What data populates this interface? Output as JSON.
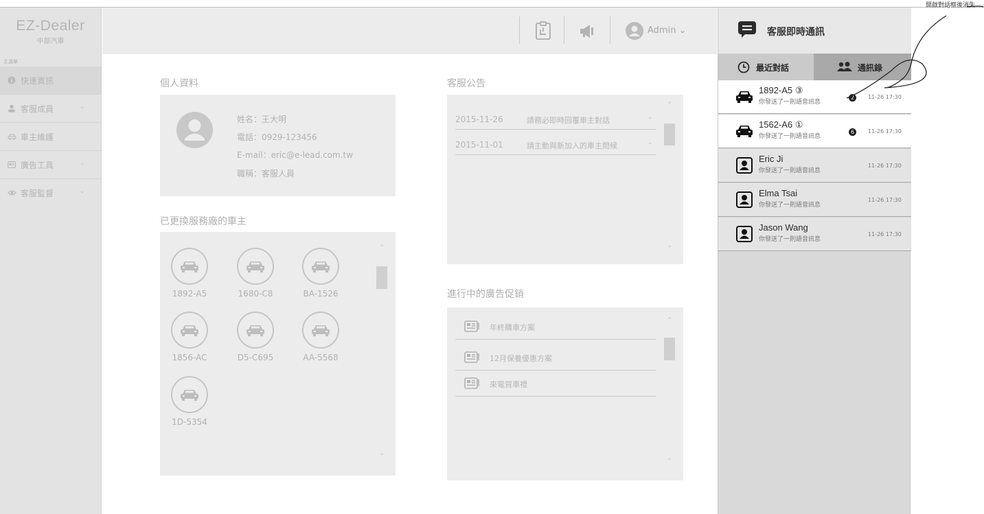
{
  "sidebar": {
    "logo_title": "EZ-Dealer",
    "logo_subtitle": "中部汽車",
    "menu_caption": "主選單",
    "items": [
      {
        "label": "快速資訊",
        "icon": "info-icon"
      },
      {
        "label": "客服成員",
        "icon": "person-icon"
      },
      {
        "label": "車主維護",
        "icon": "car-icon"
      },
      {
        "label": "廣告工具",
        "icon": "ad-icon"
      },
      {
        "label": "客服監督",
        "icon": "eye-icon"
      }
    ]
  },
  "header": {
    "admin_label": "Admin ⌄"
  },
  "profile": {
    "section_title": "個人資料",
    "name": "姓名：王大明",
    "phone": "電話：0929-123456",
    "email": "E-mail：eric@e-lead.com.tw",
    "job": "職稱：客服人員"
  },
  "owners": {
    "section_title": "已更換服務廠的車主",
    "cars": [
      "1892-A5",
      "1680-C8",
      "BA-1526",
      "1856-AC",
      "D5-C695",
      "AA-5568",
      "1D-5354"
    ]
  },
  "announcements": {
    "section_title": "客服公告",
    "items": [
      {
        "date": "2015-11-26",
        "text": "請務必即時回覆車主對話"
      },
      {
        "date": "2015-11-01",
        "text": "請主動與新加入的車主問候"
      }
    ]
  },
  "promotions": {
    "section_title": "進行中的廣告促銷",
    "items": [
      "年終購車方案",
      "12月保養優惠方案",
      "來電賀車禮"
    ]
  },
  "chat": {
    "title": "客服即時通訊",
    "tab_recent": "最近對話",
    "tab_contacts": "通訊錄",
    "conversations": [
      {
        "name": "1892-A5 ③",
        "message": "你發送了一則語音訊息",
        "badge": "2",
        "time": "11-26 17:30",
        "kind": "car"
      },
      {
        "name": "1562-A6 ①",
        "message": "你發送了一則語音訊息",
        "badge": "6",
        "time": "11-26 17:30",
        "kind": "car"
      },
      {
        "name": "Eric Ji",
        "message": "你發送了一則語音訊息",
        "badge": "",
        "time": "11-26 17:30",
        "kind": "person"
      },
      {
        "name": "Elma Tsai",
        "message": "你發送了一則語音訊息",
        "badge": "",
        "time": "11-26 17:30",
        "kind": "person"
      },
      {
        "name": "Jason Wang",
        "message": "你發送了一則語音訊息",
        "badge": "",
        "time": "11-26 17:30",
        "kind": "person"
      }
    ]
  },
  "annotation": {
    "text": "開啟對話框後消失"
  },
  "colors": {
    "sidebar_bg": "#e3e3e3",
    "header_bg": "#ececec",
    "panel_bg": "#ececec",
    "chat_bg": "#d9d9d9",
    "contacts_tab_bg": "#a9a9a9"
  }
}
